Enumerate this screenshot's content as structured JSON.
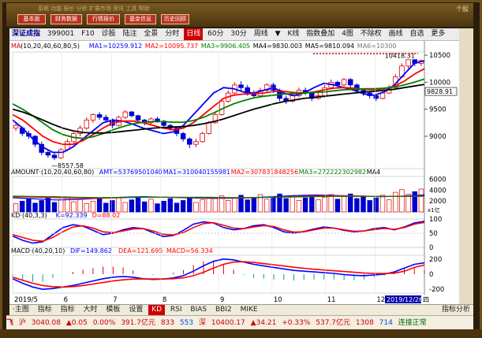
{
  "top": {
    "buttons": [
      "基本面",
      "财务数据",
      "行情报价",
      "基金信息",
      "历史回顾"
    ],
    "menu": "系统  功能  报价  分析  扩展市场  资讯  工具  帮助",
    "right_label": "个股"
  },
  "toolbar": {
    "name": "深证成指",
    "code": "399001",
    "items": [
      "F10",
      "诊股",
      "陆注",
      "全景",
      "分时",
      "日线",
      "60分",
      "30分",
      "周线",
      "▼",
      "K线",
      "指数叠加",
      "4图",
      "不除权",
      "画线",
      "自选",
      "更多"
    ],
    "active": "日线"
  },
  "ma_line": {
    "prefix": "MA·",
    "label": "(10,20,40,60,80,5)",
    "items": [
      {
        "t": "MA1=10259.912",
        "c": "#0000ff"
      },
      {
        "t": "MA2=10095.737",
        "c": "#ff0000"
      },
      {
        "t": "MA3=9906.405",
        "c": "#008000"
      },
      {
        "t": "MA4=9830.003",
        "c": "#000000"
      },
      {
        "t": "MA5=9810.094",
        "c": "#000000"
      },
      {
        "t": "MA6=10300",
        "c": "#777777"
      }
    ]
  },
  "price_axis": [
    "10500",
    "10000",
    "9500",
    "9000"
  ],
  "price_tag": "9828.91",
  "high_label": "10418.31",
  "low_label": "8557.58",
  "amount_line": {
    "label": "AMOUNT·(10,20,40,60,80)",
    "items": [
      {
        "t": "AMT=53769501040",
        "c": "#0000ff"
      },
      {
        "t": "MA1=310040155981",
        "c": "#0000ff"
      },
      {
        "t": "MA2=307831848256",
        "c": "#ff0000"
      },
      {
        "t": "MA3=272222302982",
        "c": "#008000"
      },
      {
        "t": "MA4",
        "c": "#000000"
      }
    ]
  },
  "amount_axis": [
    "6000",
    "4000",
    "2000"
  ],
  "amount_unit": "x1亿",
  "kd_line": {
    "label": "KD·(40,3,3)",
    "items": [
      {
        "t": "K=92.339",
        "c": "#0000ff"
      },
      {
        "t": "D=88.02",
        "c": "#ff0000"
      }
    ]
  },
  "kd_axis": [
    "100",
    "50",
    "0"
  ],
  "macd_line": {
    "label": "MACD·(40,20,10)",
    "items": [
      {
        "t": "DIF=149.862",
        "c": "#0000ff"
      },
      {
        "t": "DEA=121.695",
        "c": "#ff0000"
      },
      {
        "t": "MACD=56.334",
        "c": "#ff0000"
      }
    ]
  },
  "macd_axis": [
    "200",
    "0",
    "-200"
  ],
  "x_labels": [
    "2019/5",
    "6",
    "7",
    "8",
    "9",
    "10",
    "11",
    "12"
  ],
  "date_tag": "2019/12/26",
  "date_tag_day": "四",
  "tabs": [
    "指标",
    "指标",
    "大时",
    "模板",
    "设置",
    "KD",
    "RSI",
    "BIAS",
    "BBI2",
    "MIKE"
  ],
  "tab_active": "KD",
  "tab_pre": "·主图",
  "tab_post": "指标分析",
  "status": {
    "s1": "沪",
    "v1": "3040.08",
    "v2": "▲0.05",
    "v3": "0.00%",
    "v4": "391.7亿元",
    "v5": "833",
    "v6": "553",
    "s2": "深",
    "v7": "10400.17",
    "v8": "▲34.21",
    "v9": "+0.33%",
    "v10": "537.7亿元",
    "v11": "1308",
    "v12": "714",
    "s3": "连接正常",
    "logo": "飞"
  },
  "chart_data": {
    "type": "candlestick",
    "x_range": [
      "2019/5",
      "2019/12/26"
    ],
    "ylim": [
      8400,
      10560
    ],
    "candles": [
      [
        9200,
        9150,
        9250,
        9100,
        1
      ],
      [
        9150,
        9050,
        9180,
        9000,
        0
      ],
      [
        9050,
        9000,
        9100,
        8950,
        0
      ],
      [
        9000,
        8850,
        9020,
        8800,
        0
      ],
      [
        8850,
        8700,
        8900,
        8650,
        0
      ],
      [
        8700,
        8650,
        8750,
        8600,
        0
      ],
      [
        8650,
        8600,
        8700,
        8557,
        0
      ],
      [
        8600,
        8750,
        8780,
        8580,
        1
      ],
      [
        8750,
        8900,
        8950,
        8720,
        1
      ],
      [
        8900,
        9050,
        9080,
        8870,
        1
      ],
      [
        9050,
        9150,
        9200,
        9000,
        1
      ],
      [
        9150,
        9300,
        9350,
        9120,
        1
      ],
      [
        9300,
        9400,
        9420,
        9250,
        1
      ],
      [
        9400,
        9350,
        9450,
        9300,
        0
      ],
      [
        9350,
        9300,
        9400,
        9250,
        0
      ],
      [
        9300,
        9200,
        9330,
        9150,
        0
      ],
      [
        9200,
        9350,
        9380,
        9180,
        1
      ],
      [
        9350,
        9450,
        9480,
        9320,
        1
      ],
      [
        9450,
        9380,
        9470,
        9350,
        0
      ],
      [
        9380,
        9300,
        9400,
        9250,
        0
      ],
      [
        9300,
        9250,
        9320,
        9200,
        0
      ],
      [
        9250,
        9320,
        9350,
        9220,
        1
      ],
      [
        9320,
        9280,
        9360,
        9250,
        0
      ],
      [
        9280,
        9200,
        9300,
        9150,
        0
      ],
      [
        9200,
        9150,
        9230,
        9100,
        0
      ],
      [
        9150,
        9050,
        9180,
        9000,
        0
      ],
      [
        9050,
        8950,
        9080,
        8900,
        0
      ],
      [
        8950,
        8850,
        8980,
        8780,
        0
      ],
      [
        8850,
        8900,
        8950,
        8800,
        1
      ],
      [
        8900,
        9050,
        9080,
        8880,
        1
      ],
      [
        9050,
        9250,
        9280,
        9030,
        1
      ],
      [
        9250,
        9400,
        9450,
        9230,
        1
      ],
      [
        9400,
        9650,
        9700,
        9380,
        1
      ],
      [
        9650,
        9800,
        9850,
        9620,
        1
      ],
      [
        9800,
        9950,
        10000,
        9780,
        1
      ],
      [
        9950,
        9900,
        10020,
        9850,
        0
      ],
      [
        9900,
        9800,
        9950,
        9750,
        0
      ],
      [
        9800,
        9750,
        9850,
        9700,
        0
      ],
      [
        9750,
        9850,
        9900,
        9720,
        1
      ],
      [
        9850,
        9950,
        9980,
        9820,
        1
      ],
      [
        9950,
        9850,
        9990,
        9800,
        0
      ],
      [
        9850,
        9700,
        9880,
        9650,
        0
      ],
      [
        9700,
        9650,
        9750,
        9600,
        0
      ],
      [
        9650,
        9750,
        9780,
        9620,
        1
      ],
      [
        9750,
        9850,
        9900,
        9720,
        1
      ],
      [
        9850,
        9800,
        9900,
        9760,
        0
      ],
      [
        9800,
        9700,
        9830,
        9650,
        0
      ],
      [
        9700,
        9750,
        9800,
        9680,
        1
      ],
      [
        9750,
        9900,
        9950,
        9720,
        1
      ],
      [
        9900,
        10000,
        10050,
        9880,
        1
      ],
      [
        10000,
        9950,
        10030,
        9900,
        0
      ],
      [
        9950,
        10050,
        10080,
        9920,
        1
      ],
      [
        10050,
        9950,
        10080,
        9900,
        0
      ],
      [
        9950,
        9850,
        9980,
        9800,
        0
      ],
      [
        9850,
        9800,
        9880,
        9750,
        0
      ],
      [
        9800,
        9750,
        9830,
        9700,
        0
      ],
      [
        9750,
        9700,
        9780,
        9650,
        0
      ],
      [
        9700,
        9800,
        9830,
        9680,
        1
      ],
      [
        9800,
        9900,
        9950,
        9780,
        1
      ],
      [
        9900,
        10100,
        10150,
        9880,
        1
      ],
      [
        10100,
        10300,
        10350,
        10080,
        1
      ],
      [
        10300,
        10418,
        10418,
        10250,
        1
      ],
      [
        10418,
        10350,
        10418,
        10300,
        0
      ],
      [
        10350,
        10400,
        10420,
        10300,
        1
      ]
    ],
    "ma_series": [
      {
        "name": "MA1",
        "color": "#0000ff",
        "values": [
          9300,
          9150,
          8950,
          8800,
          8700,
          8700,
          8800,
          8950,
          9100,
          9250,
          9300,
          9280,
          9220,
          9150,
          9100,
          9050,
          9080,
          9200,
          9400,
          9600,
          9800,
          9900,
          9880,
          9820,
          9800,
          9850,
          9900,
          9800,
          9750,
          9800,
          9900,
          9980,
          9950,
          9900,
          9850,
          9780,
          9760,
          9820,
          9950,
          10150,
          10350,
          10400
        ]
      },
      {
        "name": "MA2",
        "color": "#ff0000",
        "values": [
          9400,
          9300,
          9150,
          9000,
          8900,
          8850,
          8850,
          8920,
          9030,
          9150,
          9250,
          9280,
          9280,
          9250,
          9200,
          9150,
          9120,
          9150,
          9250,
          9400,
          9550,
          9700,
          9760,
          9780,
          9790,
          9800,
          9830,
          9830,
          9810,
          9800,
          9820,
          9860,
          9890,
          9900,
          9890,
          9870,
          9860,
          9880,
          9930,
          10020,
          10150,
          10250
        ]
      },
      {
        "name": "MA3",
        "color": "#008000",
        "values": [
          9600,
          9500,
          9380,
          9250,
          9120,
          9030,
          8980,
          8960,
          8990,
          9050,
          9120,
          9180,
          9230,
          9260,
          9270,
          9270,
          9260,
          9260,
          9290,
          9350,
          9430,
          9520,
          9600,
          9660,
          9710,
          9740,
          9760,
          9780,
          9790,
          9800,
          9810,
          9820,
          9840,
          9860,
          9870,
          9880,
          9880,
          9890,
          9910,
          9950,
          10000,
          10060
        ]
      },
      {
        "name": "MA4",
        "color": "#000000",
        "values": [
          9500,
          9450,
          9380,
          9300,
          9220,
          9150,
          9100,
          9070,
          9060,
          9060,
          9070,
          9090,
          9110,
          9130,
          9150,
          9160,
          9170,
          9180,
          9200,
          9230,
          9270,
          9320,
          9380,
          9440,
          9500,
          9550,
          9600,
          9640,
          9670,
          9700,
          9720,
          9740,
          9760,
          9780,
          9800,
          9820,
          9830,
          9850,
          9870,
          9900,
          9930,
          9960
        ]
      }
    ],
    "kd": {
      "K": [
        40,
        25,
        15,
        20,
        45,
        70,
        80,
        75,
        60,
        45,
        50,
        62,
        70,
        66,
        52,
        38,
        42,
        60,
        82,
        90,
        86,
        70,
        62,
        66,
        76,
        80,
        70,
        55,
        50,
        56,
        65,
        72,
        68,
        60,
        55,
        58,
        66,
        70,
        62,
        72,
        86,
        92
      ],
      "D": [
        45,
        35,
        25,
        22,
        35,
        55,
        72,
        76,
        68,
        55,
        52,
        58,
        65,
        66,
        58,
        46,
        44,
        52,
        70,
        84,
        87,
        78,
        68,
        66,
        72,
        77,
        74,
        62,
        54,
        55,
        62,
        68,
        68,
        62,
        57,
        58,
        63,
        67,
        64,
        70,
        82,
        88
      ]
    },
    "macd": {
      "DIF": [
        -60,
        -120,
        -170,
        -200,
        -190,
        -170,
        -150,
        -120,
        -90,
        -60,
        -40,
        -30,
        -40,
        -60,
        -70,
        -65,
        -50,
        -20,
        40,
        110,
        170,
        200,
        190,
        160,
        130,
        110,
        90,
        70,
        50,
        40,
        30,
        20,
        10,
        -5,
        -15,
        -20,
        -10,
        0,
        30,
        80,
        130,
        150
      ],
      "DEA": [
        -40,
        -80,
        -120,
        -150,
        -165,
        -170,
        -165,
        -150,
        -130,
        -110,
        -90,
        -75,
        -65,
        -62,
        -64,
        -64,
        -60,
        -48,
        -20,
        25,
        80,
        130,
        160,
        165,
        155,
        140,
        125,
        108,
        92,
        78,
        66,
        55,
        45,
        35,
        25,
        15,
        10,
        8,
        14,
        40,
        90,
        122
      ]
    }
  }
}
